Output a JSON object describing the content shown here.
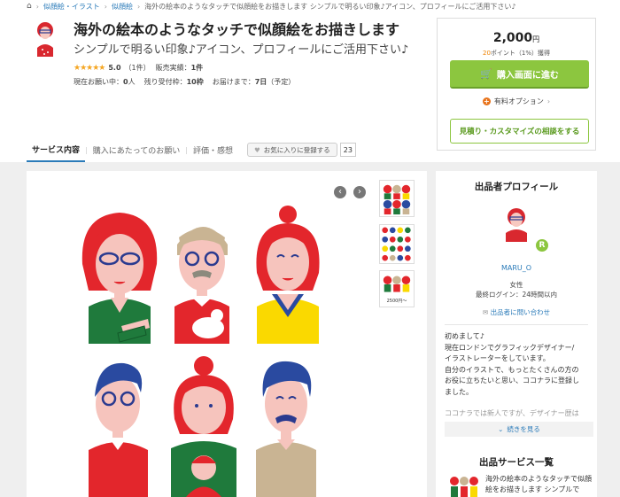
{
  "breadcrumb": {
    "items": [
      "似顔絵・イラスト",
      "似顔絵"
    ],
    "current": "海外の絵本のようなタッチで似顔絵をお描きします シンプルで明るい印象♪アイコン、プロフィールにご活用下さい♪"
  },
  "header": {
    "title": "海外の絵本のようなタッチで似顔絵をお描きします",
    "subtitle": "シンプルで明るい印象♪アイコン、プロフィールにご活用下さい♪",
    "rating": "5.0",
    "review_count": "（1件）",
    "sales_label": "販売実績：",
    "sales_value": "1件",
    "current_requests_label": "現在お願い中：",
    "current_requests_value": "0",
    "current_requests_unit": "人",
    "slots_label": "残り受付枠：",
    "slots_value": "10枠",
    "delivery_label": "お届けまで：",
    "delivery_value": "7日",
    "delivery_note": "（予定）"
  },
  "purchase": {
    "price": "2,000",
    "price_unit": "円",
    "points_value": "20",
    "points_text": "ポイント（1%）獲得",
    "buy_label": "購入画面に進む",
    "option_label": "有料オプション",
    "consult_label": "見積り・カスタマイズの相談をする"
  },
  "tabs": {
    "items": [
      "サービス内容",
      "購入にあたってのお願い",
      "評価・感想"
    ],
    "fav_label": "お気に入りに登録する",
    "fav_count": "23"
  },
  "profile": {
    "heading": "出品者プロフィール",
    "badge": "R",
    "name": "MARU_O",
    "gender": "女性",
    "last_login": "最終ログイン：24時間以内",
    "contact": "出品者に問い合わせ",
    "bio": [
      "初めまして♪",
      "現在ロンドンでグラフィックデザイナー/",
      "イラストレーターをしています。",
      "自分のイラストで、もっとたくさんの方の",
      "お役に立ちたいと思い、ココナラに登録し",
      "ました。",
      "",
      "ココナラでは新人ですが、デザイナー歴は"
    ],
    "more_label": "続きを見る"
  },
  "services": {
    "heading": "出品サービス一覧",
    "first_title": "海外の絵本のようなタッチで似顔絵をお描きします シンプルで"
  },
  "gallery": {
    "thumb_caption": "2500円〜"
  },
  "colors": {
    "accent_blue": "#2b7bb9",
    "buy_green": "#8cc63f",
    "star_orange": "#f5a623",
    "point_orange": "#f08300"
  }
}
